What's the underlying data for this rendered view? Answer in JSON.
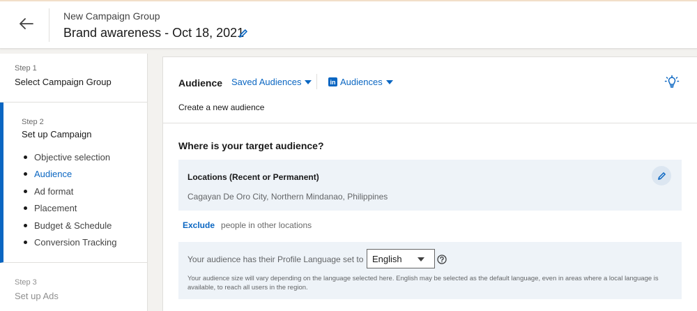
{
  "colors": {
    "accent": "#0a66c2",
    "panel_bg": "#eef3f8",
    "page_bg": "#f3f2ef"
  },
  "header": {
    "subtitle": "New Campaign Group",
    "title": "Brand awareness - Oct 18, 2021",
    "back_icon": "arrow-left-icon",
    "edit_icon": "pencil-icon"
  },
  "sidebar": {
    "step1": {
      "number": "Step 1",
      "title": "Select Campaign Group"
    },
    "step2": {
      "number": "Step 2",
      "title": "Set up Campaign",
      "substeps": [
        {
          "label": "Objective selection",
          "active": false
        },
        {
          "label": "Audience",
          "active": true
        },
        {
          "label": "Ad format",
          "active": false
        },
        {
          "label": "Placement",
          "active": false
        },
        {
          "label": "Budget & Schedule",
          "active": false
        },
        {
          "label": "Conversion Tracking",
          "active": false
        }
      ]
    },
    "step3": {
      "number": "Step 3",
      "title": "Set up Ads"
    }
  },
  "audience": {
    "label": "Audience",
    "saved_dropdown": "Saved Audiences",
    "linkedin_dropdown": "Audiences",
    "linkedin_logo": "in",
    "tip_icon": "lightbulb-icon",
    "create_text": "Create a new audience",
    "where_title": "Where is your target audience?",
    "locations": {
      "title": "Locations (Recent or Permanent)",
      "value": "Cagayan De Oro City, Northern Mindanao, Philippines",
      "edit_icon": "pencil-icon"
    },
    "exclude": {
      "link": "Exclude",
      "text": "people in other locations"
    },
    "language": {
      "label": "Your audience has their Profile Language set to",
      "selected": "English",
      "help_icon": "question-circle-icon",
      "note": "Your audience size will vary depending on the language selected here. English may be selected as the default language, even in areas where a local language is available, to reach all users in the region."
    }
  }
}
